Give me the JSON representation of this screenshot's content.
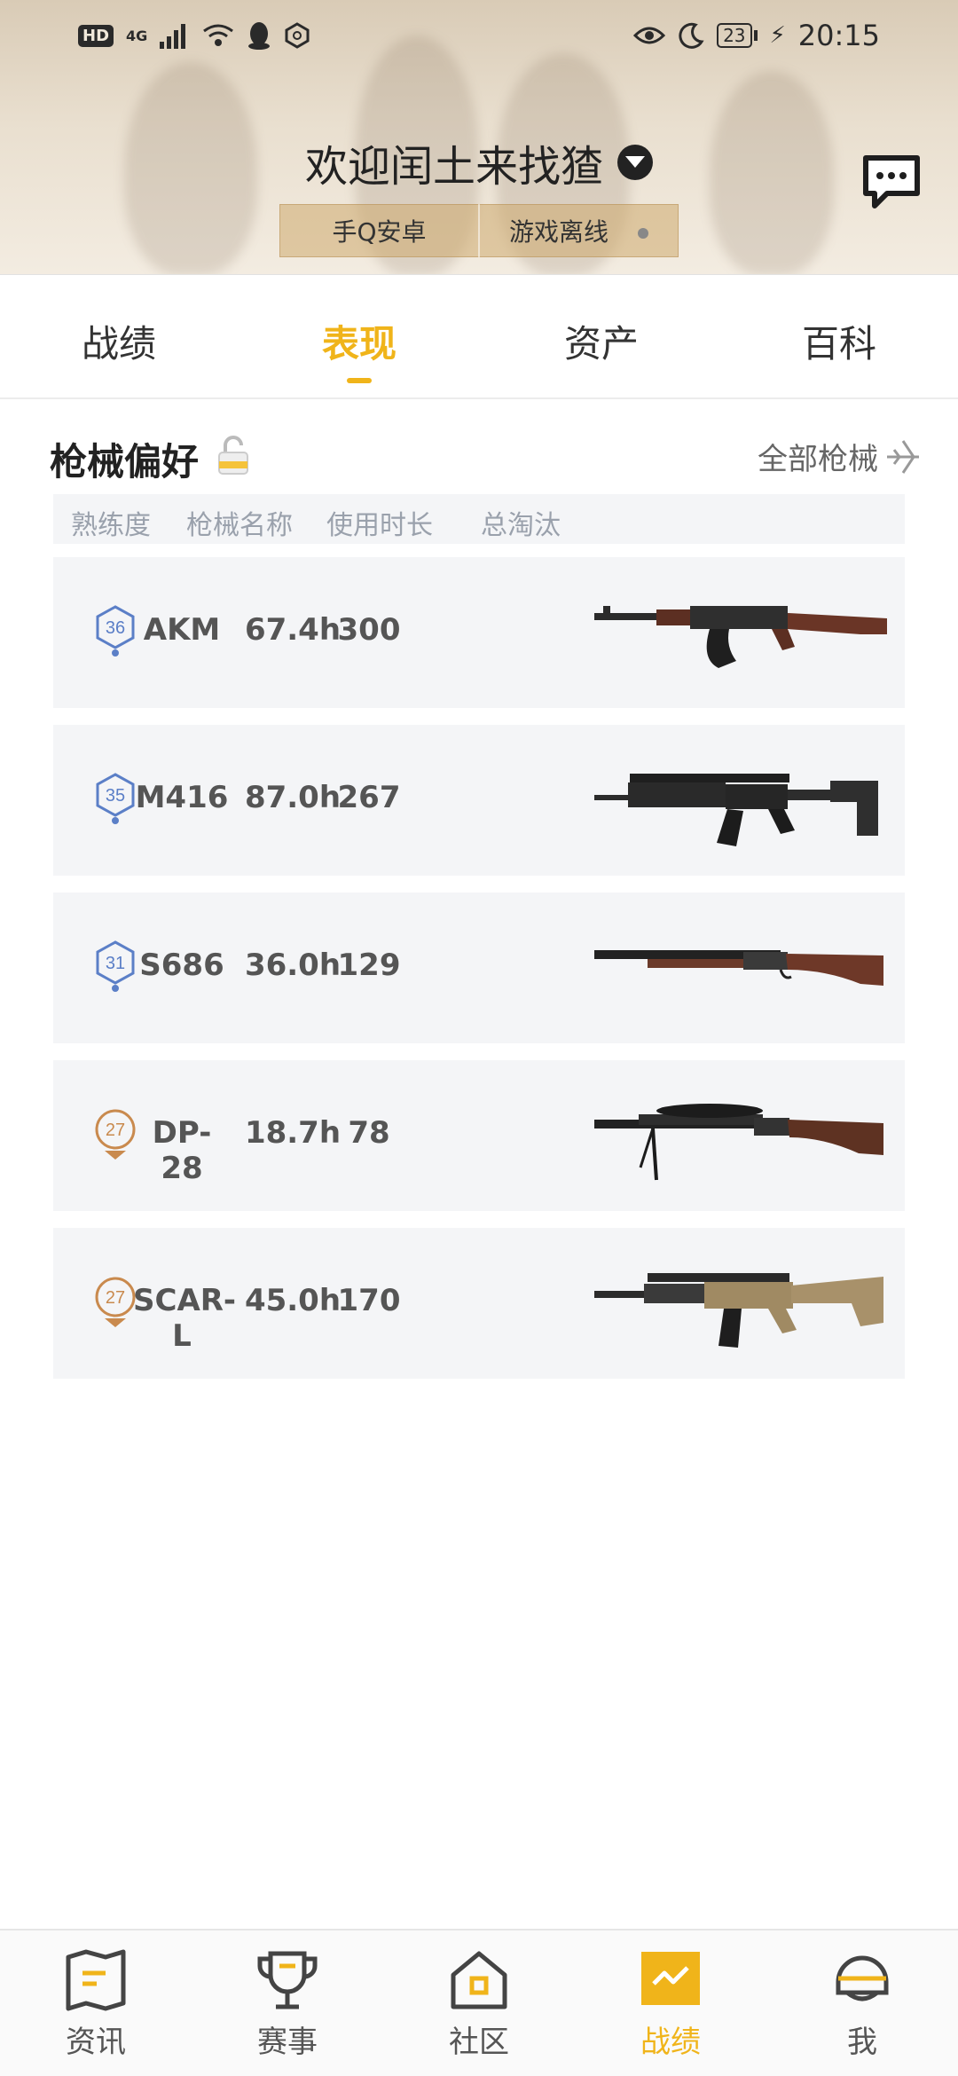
{
  "status_bar": {
    "hd": "HD",
    "network": "4G",
    "battery": "23",
    "time": "20:15"
  },
  "header": {
    "welcome": "欢迎闰土来找猹",
    "account_type": "手Q安卓",
    "game_status": "游戏离线"
  },
  "tabs": [
    {
      "label": "战绩"
    },
    {
      "label": "表现"
    },
    {
      "label": "资产"
    },
    {
      "label": "百科"
    }
  ],
  "section": {
    "title": "枪械偏好",
    "all_link": "全部枪械",
    "columns": [
      "熟练度",
      "枪械名称",
      "使用时长",
      "总淘汰"
    ]
  },
  "weapons": [
    {
      "level": "36",
      "level_color": "#5b7fc7",
      "name": "AKM",
      "hours": "67.4h",
      "kills": "300"
    },
    {
      "level": "35",
      "level_color": "#5b7fc7",
      "name": "M416",
      "hours": "87.0h",
      "kills": "267"
    },
    {
      "level": "31",
      "level_color": "#5b7fc7",
      "name": "S686",
      "hours": "36.0h",
      "kills": "129"
    },
    {
      "level": "27",
      "level_color": "#c98a4e",
      "name": "DP-28",
      "hours": "18.7h",
      "kills": "78"
    },
    {
      "level": "27",
      "level_color": "#c98a4e",
      "name": "SCAR-L",
      "hours": "45.0h",
      "kills": "170"
    }
  ],
  "bottom_nav": [
    {
      "label": "资讯",
      "icon": "news-icon"
    },
    {
      "label": "赛事",
      "icon": "trophy-icon"
    },
    {
      "label": "社区",
      "icon": "home-icon"
    },
    {
      "label": "战绩",
      "icon": "chart-icon"
    },
    {
      "label": "我",
      "icon": "helmet-icon"
    }
  ],
  "colors": {
    "accent": "#f0b41a",
    "row_bg": "#f4f5f7"
  }
}
